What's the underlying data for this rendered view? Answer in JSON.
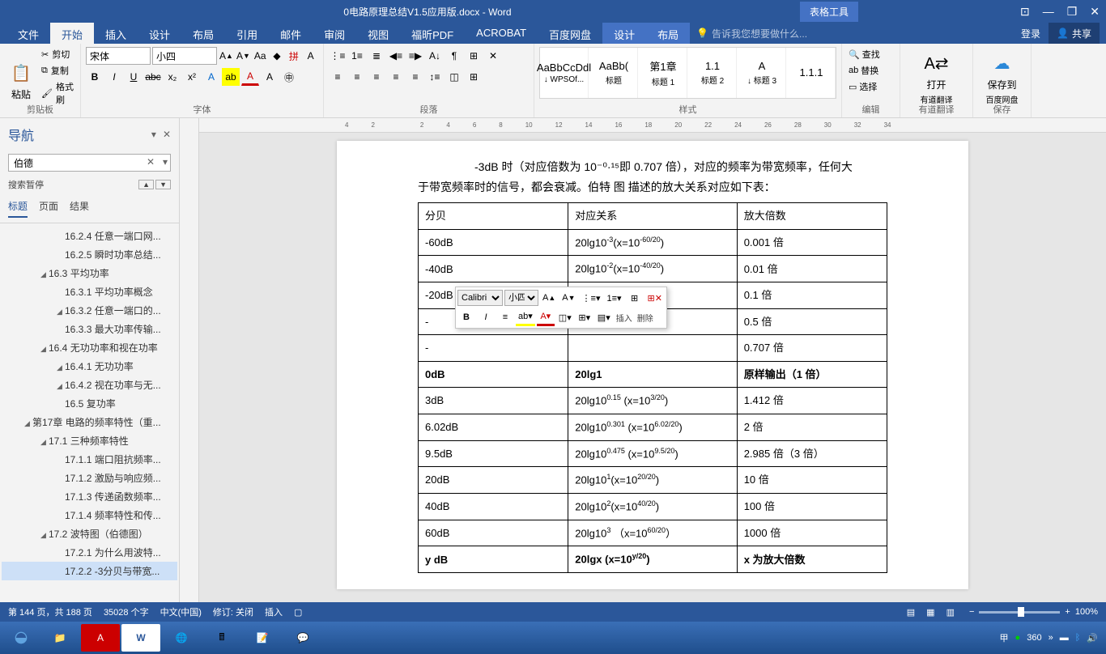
{
  "title_bar": {
    "document_title": "0电路原理总结V1.5应用版.docx - Word",
    "tools_label": "表格工具"
  },
  "window_controls": {
    "options": "⊡",
    "minimize": "—",
    "restore": "❐",
    "close": "✕"
  },
  "ribbon_tabs": {
    "file": "文件",
    "home": "开始",
    "insert": "插入",
    "design": "设计",
    "layout": "布局",
    "references": "引用",
    "mailings": "邮件",
    "review": "审阅",
    "view": "视图",
    "foxit": "福昕PDF",
    "acrobat": "ACROBAT",
    "baidu": "百度网盘",
    "table_design": "设计",
    "table_layout": "布局",
    "tell_me": "告诉我您想要做什么...",
    "account": "登录",
    "share": "共享"
  },
  "ribbon": {
    "clipboard": {
      "paste": "粘贴",
      "cut": "剪切",
      "copy": "复制",
      "format_painter": "格式刷",
      "label": "剪贴板"
    },
    "font": {
      "name": "宋体",
      "size": "小四",
      "label": "字体"
    },
    "paragraph": {
      "label": "段落"
    },
    "styles": {
      "label": "样式",
      "items": [
        {
          "preview": "AaBbCcDdl",
          "name": "↓ WPSOf..."
        },
        {
          "preview": "AaBb(",
          "name": "标题"
        },
        {
          "preview": "第1章",
          "name": "标题 1"
        },
        {
          "preview": "1.1",
          "name": "标题 2"
        },
        {
          "preview": "A",
          "name": "↓ 标题 3"
        },
        {
          "preview": "1.1.1",
          "name": ""
        }
      ]
    },
    "editing": {
      "find": "查找",
      "replace": "替换",
      "select": "选择",
      "label": "编辑"
    },
    "translate": {
      "open": "打开",
      "doc_trans": "有道翻译",
      "label": "有道翻译"
    },
    "save": {
      "save_to": "保存到",
      "baidu": "百度网盘",
      "label": "保存"
    }
  },
  "nav": {
    "title": "导航",
    "search_value": "伯德",
    "status": "搜索暂停",
    "tabs": {
      "headings": "标题",
      "pages": "页面",
      "results": "结果"
    },
    "tree": [
      {
        "level": 3,
        "text": "16.2.4 任意一端口网...",
        "caret": false
      },
      {
        "level": 3,
        "text": "16.2.5 瞬时功率总结...",
        "caret": false
      },
      {
        "level": 2,
        "text": "16.3  平均功率",
        "caret": true
      },
      {
        "level": 3,
        "text": "16.3.1 平均功率概念",
        "caret": false
      },
      {
        "level": 3,
        "text": "16.3.2 任意一端口的...",
        "caret": true
      },
      {
        "level": 3,
        "text": "16.3.3 最大功率传输...",
        "caret": false
      },
      {
        "level": 2,
        "text": "16.4  无功功率和视在功率",
        "caret": true
      },
      {
        "level": 3,
        "text": "16.4.1 无功功率",
        "caret": true
      },
      {
        "level": 3,
        "text": "16.4.2 视在功率与无...",
        "caret": true
      },
      {
        "level": 3,
        "text": "16.5  复功率",
        "caret": false
      },
      {
        "level": 1,
        "text": "第17章 电路的频率特性（重...",
        "caret": true
      },
      {
        "level": 2,
        "text": "17.1  三种频率特性",
        "caret": true
      },
      {
        "level": 3,
        "text": "17.1.1 端口阻抗频率...",
        "caret": false
      },
      {
        "level": 3,
        "text": "17.1.2 激励与响应频...",
        "caret": false
      },
      {
        "level": 3,
        "text": "17.1.3 传递函数频率...",
        "caret": false
      },
      {
        "level": 3,
        "text": "17.1.4 频率特性和传...",
        "caret": false
      },
      {
        "level": 2,
        "text": "17.2  波特图（伯德图）",
        "caret": true
      },
      {
        "level": 3,
        "text": "17.2.1  为什么用波特...",
        "caret": false
      },
      {
        "level": 3,
        "text": "17.2.2  -3分贝与带宽...",
        "caret": false,
        "selected": true
      }
    ]
  },
  "document": {
    "para1": "-3dB 时（对应倍数为 10⁻⁰·¹⁵即 0.707 倍），对应的频率为带宽频率，任何大",
    "para2": "于带宽频率时的信号，都会衰减。伯特 图 描述的放大关系对应如下表：",
    "table_header": [
      "分贝",
      "对应关系",
      "放大倍数"
    ],
    "table_rows": [
      {
        "c1": "-60dB",
        "c2_pre": "20lg10",
        "c2_sup": "-3",
        "c2_post": "(x=10",
        "c2_sup2": "-60/20",
        "c2_end": ")",
        "c3": "0.001 倍"
      },
      {
        "c1": "-40dB",
        "c2_pre": "20lg10",
        "c2_sup": "-2",
        "c2_post": "(x=10",
        "c2_sup2": "-40/20",
        "c2_end": ")",
        "c3": "0.01 倍"
      },
      {
        "c1": "-20dB",
        "c2_pre": "20lg10",
        "c2_sup": "-1",
        "c2_post": "(x=10",
        "c2_sup2": "-20/20",
        "c2_end": ")",
        "c3": "0.1 倍"
      },
      {
        "c1": "-",
        "c2_hidden": true,
        "c3": "0.5 倍"
      },
      {
        "c1": "-",
        "c2_hidden": true,
        "c3": "0.707 倍"
      },
      {
        "c1": "0dB",
        "c2_plain": "20lg1",
        "c3": "原样输出（1 倍）",
        "bold": true
      },
      {
        "c1": "3dB",
        "c2_pre": "20lg10",
        "c2_sup": "0.15",
        "c2_post": " (x=10",
        "c2_sup2": "3/20",
        "c2_end": ")",
        "c3": "1.412 倍"
      },
      {
        "c1": "6.02dB",
        "c2_pre": "20lg10",
        "c2_sup": "0.301",
        "c2_post": " (x=10",
        "c2_sup2": "6.02/20",
        "c2_end": ")",
        "c3": "2 倍"
      },
      {
        "c1": "9.5dB",
        "c2_pre": "20lg10",
        "c2_sup": "0.475",
        "c2_post": " (x=10",
        "c2_sup2": "9.5/20",
        "c2_end": ")",
        "c3": "2.985 倍（3 倍）"
      },
      {
        "c1": "20dB",
        "c2_pre": "20lg10",
        "c2_sup": "1",
        "c2_post": "(x=10",
        "c2_sup2": "20/20",
        "c2_end": ")",
        "c3": "10 倍"
      },
      {
        "c1": "40dB",
        "c2_pre": "20lg10",
        "c2_sup": "2",
        "c2_post": "(x=10",
        "c2_sup2": "40/20",
        "c2_end": ")",
        "c3": "100 倍"
      },
      {
        "c1": "60dB",
        "c2_pre": "20lg10",
        "c2_sup": "3",
        "c2_post": "   （x=10",
        "c2_sup2": "60/20",
        "c2_end": "）",
        "c3": "1000 倍"
      },
      {
        "c1": "y dB",
        "c2_pre": "20lgx (x=10",
        "c2_sup": "y/20",
        "c2_post": ")",
        "c3": "x 为放大倍数",
        "bold": true
      }
    ]
  },
  "mini_toolbar": {
    "font": "Calibri",
    "size": "小四",
    "insert": "插入",
    "delete": "删除"
  },
  "status_bar": {
    "page": "第 144 页，共 188 页",
    "words": "35028 个字",
    "lang": "中文(中国)",
    "track": "修订: 关闭",
    "insert_mode": "插入",
    "zoom": "100%"
  },
  "tray": {
    "ime": "甲",
    "av": "360",
    "expand": "»"
  }
}
